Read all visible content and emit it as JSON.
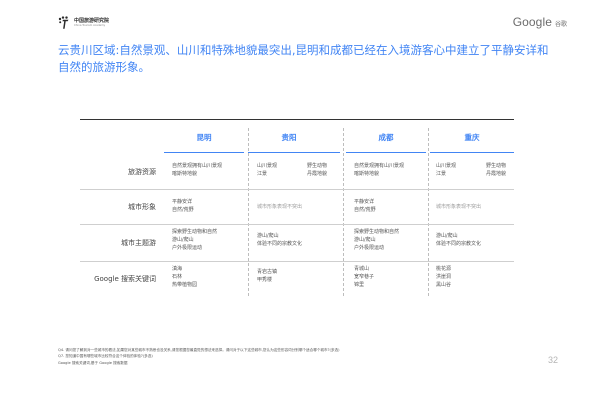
{
  "header": {
    "org_name": "中国旅游研究院",
    "org_sub": "China Tourism Academy",
    "brand": "Google",
    "brand_cn": "谷歌"
  },
  "headline": "云贵川区域:自然景观、山川和特殊地貌最突出,昆明和成都已经在入境游客心中建立了平静安详和自然的旅游形象。",
  "table": {
    "columns": [
      "昆明",
      "贵阳",
      "成都",
      "重庆"
    ],
    "rows": [
      {
        "label": "旅游资源",
        "cells": [
          {
            "lines": [
              "自然景观拥有山川景观",
              "喀斯特地貌"
            ]
          },
          {
            "pairs": [
              [
                "山川景观",
                "野生动物"
              ],
              [
                "江景",
                "丹霞地貌"
              ]
            ]
          },
          {
            "lines": [
              "自然景观拥有山川景观",
              "喀斯特地貌"
            ]
          },
          {
            "pairs": [
              [
                "山川景观",
                "野生动物"
              ],
              [
                "江景",
                "丹霞地貌"
              ]
            ]
          }
        ]
      },
      {
        "label": "城市形象",
        "cells": [
          {
            "lines": [
              "平静安详",
              "自然/荒野"
            ]
          },
          {
            "muted": "城市形象表现不突出"
          },
          {
            "lines": [
              "平静安详",
              "自然/荒野"
            ]
          },
          {
            "muted": "城市形象表现不突出"
          }
        ]
      },
      {
        "label": "城市主题游",
        "cells": [
          {
            "lines": [
              "探索野生动物和自然",
              "游山/爬山",
              "户外极限运动"
            ]
          },
          {
            "lines": [
              "游山/爬山",
              "体验不同的宗教文化"
            ]
          },
          {
            "lines": [
              "探索野生动物和自然",
              "游山/爬山",
              "户外极限运动"
            ]
          },
          {
            "lines": [
              "游山/爬山",
              "体验不同的宗教文化"
            ]
          }
        ]
      },
      {
        "label": "Google 搜索关键词",
        "cells": [
          {
            "lines": [
              "滇海",
              "石林",
              "热带植物园"
            ]
          },
          {
            "lines": [
              "青岩古镇",
              "甲秀楼"
            ]
          },
          {
            "lines": [
              "青城山",
              "宽窄巷子",
              "锦里"
            ]
          },
          {
            "lines": [
              "桃花源",
              "洪崖洞",
              "黑山谷"
            ]
          }
        ]
      }
    ]
  },
  "footnotes": [
    "Q4. 请问您了解到对一些城市的看法,如果您对某些城市不熟悉也没关系,请您根据您最直觉的想法来选择。请问对于以下这些城市,您认为这些形容词分别哪个适合哪个城市?(多选)",
    "Q7. 您知道中国有哪些城市比较符合这个体验的体验?(多选)",
    "Google 搜索关键词,基于 Google 搜索数据"
  ],
  "page_number": "32",
  "colors": {
    "accent": "#4285f4",
    "text": "#333333",
    "muted": "#9a9a9a"
  }
}
